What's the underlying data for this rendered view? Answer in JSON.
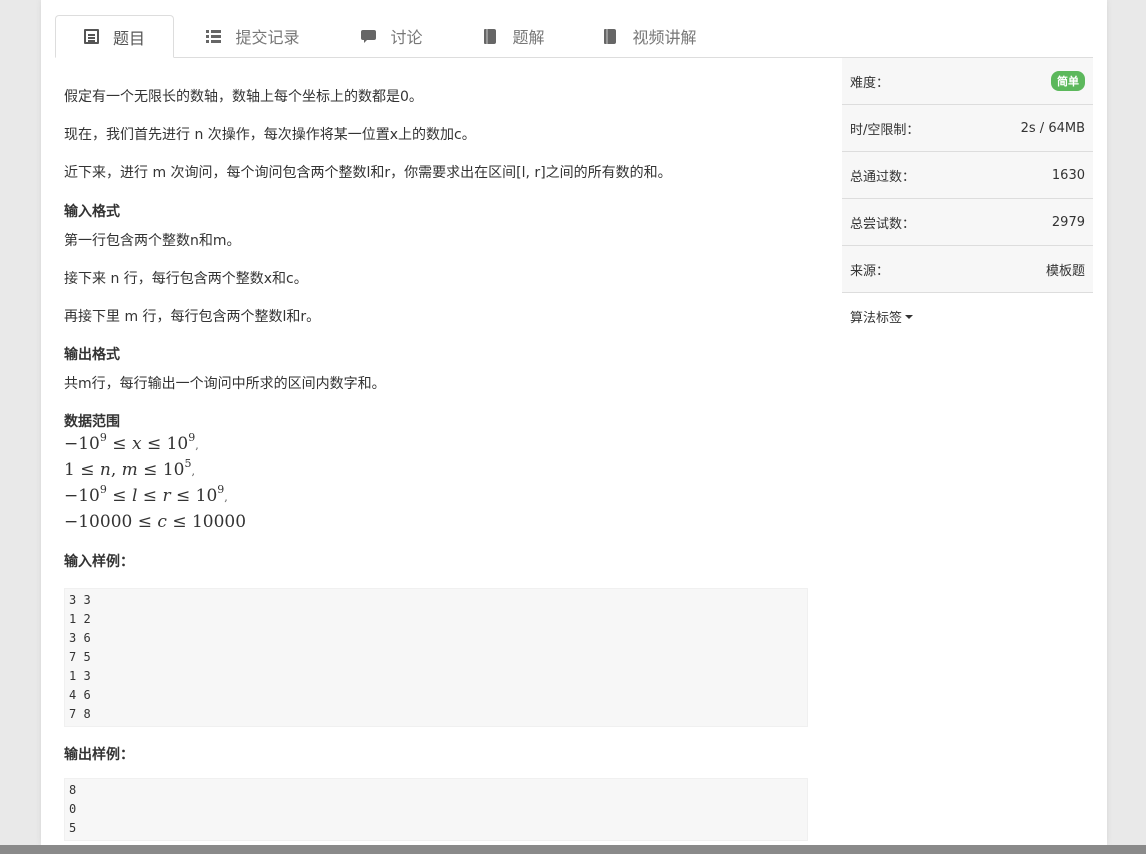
{
  "tabs": [
    {
      "label": "题目",
      "icon": "doc-icon",
      "active": true
    },
    {
      "label": "提交记录",
      "icon": "list-icon",
      "active": false
    },
    {
      "label": "讨论",
      "icon": "chat-icon",
      "active": false
    },
    {
      "label": "题解",
      "icon": "book-icon",
      "active": false
    },
    {
      "label": "视频讲解",
      "icon": "book-icon",
      "active": false
    }
  ],
  "problem": {
    "p1": "假定有一个无限长的数轴，数轴上每个坐标上的数都是0。",
    "p2": "现在，我们首先进行 n 次操作，每次操作将某一位置x上的数加c。",
    "p3": "近下来，进行 m 次询问，每个询问包含两个整数l和r，你需要求出在区间[l, r]之间的所有数的和。",
    "input_heading": "输入格式",
    "input_l1": "第一行包含两个整数n和m。",
    "input_l2": "接下来 n 行，每行包含两个整数x和c。",
    "input_l3": "再接下里 m 行，每行包含两个整数l和r。",
    "output_heading": "输出格式",
    "output_l1": "共m行，每行输出一个询问中所求的区间内数字和。",
    "range_heading": "数据范围",
    "sample_in_heading": "输入样例：",
    "sample_in": "3 3\n1 2\n3 6\n7 5\n1 3\n4 6\n7 8",
    "sample_out_heading": "输出样例：",
    "sample_out": "8\n0\n5"
  },
  "sidebar": {
    "difficulty_label": "难度：",
    "difficulty_value": "简单",
    "limit_label": "时/空限制：",
    "limit_value": "2s / 64MB",
    "passed_label": "总通过数：",
    "passed_value": "1630",
    "tried_label": "总尝试数：",
    "tried_value": "2979",
    "source_label": "来源：",
    "source_value": "模板题",
    "tags_label": "算法标签"
  },
  "colors": {
    "badge": "#5cb85c",
    "background": "#e9e9e9"
  }
}
